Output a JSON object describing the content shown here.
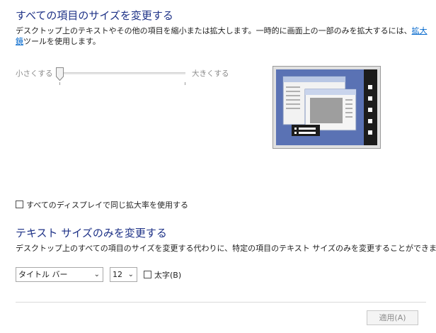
{
  "section1": {
    "title": "すべての項目のサイズを変更する",
    "desc_before": "デスクトップ上のテキストやその他の項目を縮小または拡大します。一時的に画面上の一部のみを拡大するには、",
    "link": "拡大鏡",
    "desc_after": "ツールを使用します。"
  },
  "slider": {
    "min_label": "小さくする",
    "max_label": "大きくする",
    "value_fraction": 0
  },
  "same_scale_checkbox": {
    "label": "すべてのディスプレイで同じ拡大率を使用する",
    "checked": false
  },
  "section2": {
    "title": "テキスト サイズのみを変更する",
    "desc": "デスクトップ上のすべての項目のサイズを変更する代わりに、特定の項目のテキスト サイズのみを変更することができます。"
  },
  "item_select": {
    "value": "タイトル バー"
  },
  "size_select": {
    "value": "12"
  },
  "bold_checkbox": {
    "label": "太字(B)",
    "checked": false
  },
  "apply_button": {
    "label": "適用(A)",
    "enabled": false
  },
  "colors": {
    "heading": "#1e3287",
    "link": "#0066cc",
    "preview_screen": "#5a72b4"
  }
}
